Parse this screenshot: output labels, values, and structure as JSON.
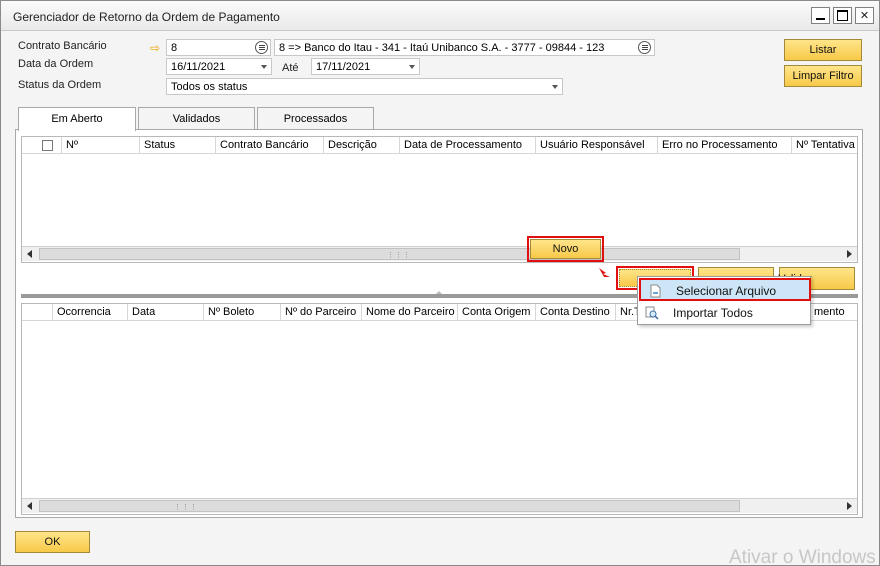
{
  "window": {
    "title": "Gerenciador de Retorno da Ordem de Pagamento"
  },
  "filters": {
    "contrato_label": "Contrato Bancário",
    "contrato_value": "8",
    "contrato_desc": "8 => Banco do Itau - 341 - Itaú Unibanco  S.A. - 3777 - 09844 - 123",
    "data_label": "Data da Ordem",
    "data_from": "16/11/2021",
    "ate_label": "Até",
    "data_to": "17/11/2021",
    "status_label": "Status da Ordem",
    "status_value": "Todos os status"
  },
  "buttons": {
    "listar": "Listar",
    "limpar": "Limpar Filtro",
    "novo": "Novo",
    "validar": "Validar",
    "ok": "OK"
  },
  "tabs": [
    {
      "label": "Em Aberto",
      "active": true
    },
    {
      "label": "Validados",
      "active": false
    },
    {
      "label": "Processados",
      "active": false
    }
  ],
  "top_grid": {
    "columns": [
      "Nº",
      "Status",
      "Contrato Bancário",
      "Descrição",
      "Data de Processamento",
      "Usuário Responsável",
      "Erro no Processamento",
      "Nº Tentativa"
    ]
  },
  "bottom_grid": {
    "columns": [
      "Ocorrencia",
      "Data",
      "Nº Boleto",
      "Nº do Parceiro",
      "Nome do Parceiro",
      "Conta Origem",
      "Conta Destino",
      "Nr.T",
      "mento"
    ]
  },
  "context_menu": {
    "items": [
      {
        "label": "Selecionar Arquivo",
        "icon": "file-icon",
        "selected": true
      },
      {
        "label": "Importar Todos",
        "icon": "magnifier-icon",
        "selected": false
      }
    ]
  },
  "watermark": "Ativar o Windows",
  "colors": {
    "accent_yellow": "#f7c948",
    "highlight_red": "#e01010",
    "menu_selection": "#cde6f7"
  }
}
